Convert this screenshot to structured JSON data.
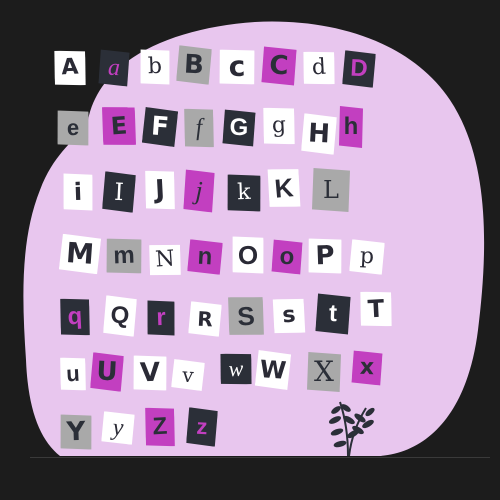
{
  "colors": {
    "background": "#1c1c1c",
    "blob": "#e8c6ee",
    "pink": "#c23fc0",
    "dark": "#2b2f38",
    "grey": "#a9a9a9",
    "white": "#ffffff"
  },
  "letters": {
    "A": "A",
    "a": "a",
    "b": "b",
    "B": "B",
    "c": "c",
    "C": "C",
    "d": "d",
    "D": "D",
    "e": "e",
    "E": "E",
    "F": "F",
    "f": "f",
    "G": "G",
    "g": "g",
    "H": "H",
    "h": "h",
    "i": "i",
    "I": "I",
    "J": "J",
    "j": "j",
    "k": "k",
    "K": "K",
    "L": "L",
    "M": "M",
    "m": "m",
    "N": "N",
    "n": "n",
    "O": "O",
    "o": "o",
    "P": "P",
    "p": "p",
    "q": "q",
    "Q": "Q",
    "r": "r",
    "R": "R",
    "S": "S",
    "s": "s",
    "t": "t",
    "T": "T",
    "u": "u",
    "U": "U",
    "V": "V",
    "v": "v",
    "w": "w",
    "W": "W",
    "X": "X",
    "x": "x",
    "Y": "Y",
    "y": "y",
    "Z": "Z",
    "z": "z"
  },
  "icons": {
    "plant": "plant-sprig-icon"
  }
}
